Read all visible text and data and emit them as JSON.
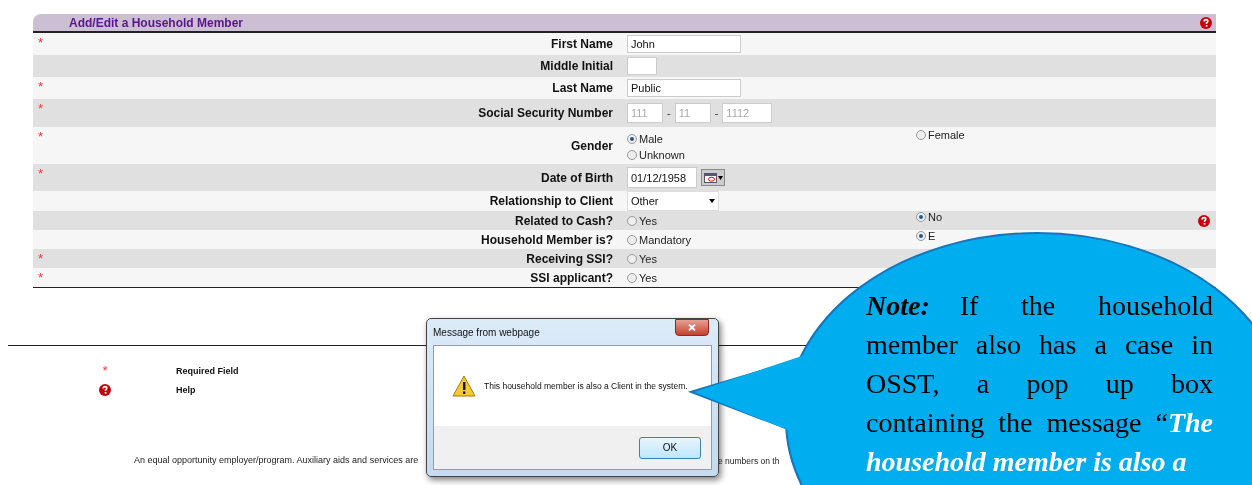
{
  "form": {
    "title": "Add/Edit a Household Member",
    "rows": [
      {
        "label": "First Name",
        "required": "*",
        "kind": "text",
        "value": "John"
      },
      {
        "label": "Middle Initial",
        "kind": "text"
      },
      {
        "label": "Last Name",
        "required": "*",
        "kind": "text",
        "value": "Public"
      },
      {
        "label": "Social Security Number",
        "required": "*",
        "kind": "ssn",
        "placeholders": [
          "111",
          "11",
          "1112"
        ],
        "separators": [
          "-",
          "-"
        ]
      },
      {
        "label": "Gender",
        "required": "*",
        "kind": "radio",
        "options": [
          {
            "label": "Male",
            "selected": true
          },
          {
            "label": "Female",
            "selected": false
          },
          {
            "label": "Unknown",
            "selected": false
          }
        ]
      },
      {
        "label": "Date of Birth",
        "required": "*",
        "kind": "date",
        "value": "01/12/1958"
      },
      {
        "label": "Relationship to Client",
        "kind": "select",
        "value": "Other"
      },
      {
        "label": "Related to Cash?",
        "kind": "radio",
        "help": true,
        "options": [
          {
            "label": "Yes",
            "selected": false
          },
          {
            "label": "No",
            "selected": true
          }
        ]
      },
      {
        "label": "Household Member is?",
        "kind": "radio",
        "options": [
          {
            "label": "Mandatory",
            "selected": false
          },
          {
            "label": "E",
            "selected": true
          }
        ]
      },
      {
        "label": "Receiving SSI?",
        "required": "*",
        "kind": "radio",
        "options": [
          {
            "label": "Yes",
            "selected": false
          }
        ]
      },
      {
        "label": "SSI applicant?",
        "required": "*",
        "kind": "radio",
        "options": [
          {
            "label": "Yes",
            "selected": false
          }
        ]
      }
    ]
  },
  "legend": [
    {
      "kind": "required",
      "symbol": "*",
      "label": "Required Field"
    },
    {
      "kind": "help",
      "label": "Help"
    }
  ],
  "footer": {
    "text_start": "An equal opportunity employer/program. Auxiliary aids and services are",
    "text_end": "e numbers on th"
  },
  "dialog": {
    "title": "Message from webpage",
    "message": "This household member is also a Client in the system.",
    "button": "OK"
  },
  "callout": {
    "note_label": "Note:",
    "text": "If the household member also has a case in OSST, a pop up box containing the message “",
    "quote": "The household member is also a"
  }
}
